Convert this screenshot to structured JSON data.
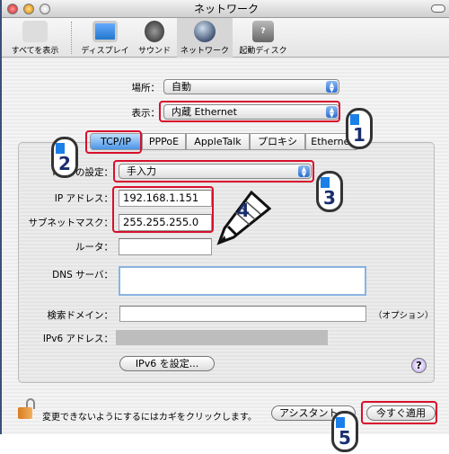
{
  "window": {
    "title": "ネットワーク"
  },
  "toolbar": {
    "items": [
      {
        "label": "すべてを表示",
        "icon": "apple-icon"
      },
      {
        "label": "ディスプレイ",
        "icon": "display-icon"
      },
      {
        "label": "サウンド",
        "icon": "speaker-icon"
      },
      {
        "label": "ネットワーク",
        "icon": "globe-icon",
        "selected": true
      },
      {
        "label": "起動ディスク",
        "icon": "disk-icon"
      }
    ]
  },
  "location": {
    "label": "場所：",
    "value": "自動"
  },
  "show": {
    "label": "表示：",
    "value": "内蔵 Ethernet"
  },
  "tabs": [
    "TCP/IP",
    "PPPoE",
    "AppleTalk",
    "プロキシ",
    "Ethernet"
  ],
  "tcpip": {
    "config_label": "IPv4 の設定：",
    "config_value": "手入力",
    "ip_label": "IP アドレス：",
    "ip_value": "192.168.1.151",
    "subnet_label": "サブネットマスク：",
    "subnet_value": "255.255.255.0",
    "router_label": "ルータ：",
    "router_value": "",
    "dns_label": "DNS サーバ：",
    "dns_value": "",
    "search_label": "検索ドメイン：",
    "search_value": "",
    "search_hint": "（オプション）",
    "ipv6_label": "IPv6 アドレス：",
    "ipv6_button": "IPv6 を設定...",
    "help": "?"
  },
  "footer": {
    "lock_text": "変更できないようにするにはカギをクリックします。",
    "assistant": "アシスタント...",
    "apply": "今すぐ適用"
  },
  "annotations": [
    "1",
    "2",
    "3",
    "4",
    "5"
  ],
  "colors": {
    "highlight": "#d8102c",
    "accent": "#2c6fd0"
  }
}
